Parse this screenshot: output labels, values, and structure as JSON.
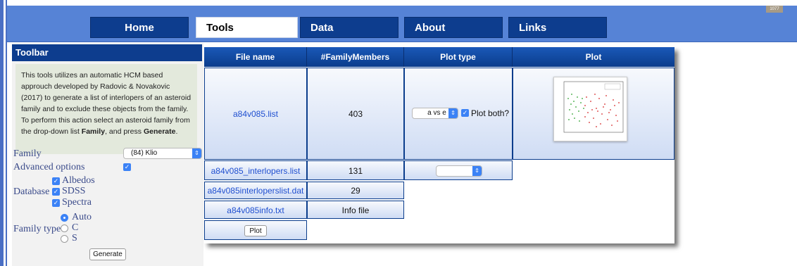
{
  "corner_badge": "1077",
  "nav": {
    "items": [
      {
        "label": "Home",
        "active": false
      },
      {
        "label": "Tools",
        "active": true
      },
      {
        "label": "Data",
        "active": false
      },
      {
        "label": "About",
        "active": false
      },
      {
        "label": "Links",
        "active": false
      }
    ]
  },
  "sidebar": {
    "toolbar_title": "Toolbar",
    "info_text_1": "This tools utilizes an automatic HCM based approuch developed by Radovic & Novakovic (2017) to generate a list of interlopers of an asteroid family and to exclude these objects from the family. To perform this action select an asteroid family from the drop-down list ",
    "info_bold_1": "Family",
    "info_text_2": ", and press ",
    "info_bold_2": "Generate",
    "info_text_3": ".",
    "family_label": "Family",
    "family_value": "(84) Klio",
    "advanced_label": "Advanced options",
    "advanced_checked": true,
    "database_label": "Database",
    "db_albedos": "Albedos",
    "db_sdss": "SDSS",
    "db_spectra": "Spectra",
    "family_type_label": "Family type",
    "type_auto": "Auto",
    "type_c": "C",
    "type_s": "S",
    "type_selected": "Auto",
    "generate_label": "Generate"
  },
  "table": {
    "headers": [
      "File name",
      "#FamilyMembers",
      "Plot type",
      "Plot"
    ],
    "rows": [
      {
        "file": "a84v085.list",
        "members": "403"
      },
      {
        "file": "a84v085_interlopers.list",
        "members": "131"
      },
      {
        "file": "a84v085interloperslist.dat",
        "members": "29"
      },
      {
        "file": "a84v085info.txt",
        "members": "Info file"
      }
    ],
    "plot_type_value": "a vs e",
    "plot_both_label": "Plot both?",
    "plot_both_checked": true,
    "second_select_value": "",
    "plot_button_label": "Plot"
  },
  "colors": {
    "nav_bg": "#5683d6",
    "nav_item": "#0d3d8e",
    "accent": "#3b82f6",
    "cell_grad_bottom": "#cfdcf4"
  }
}
